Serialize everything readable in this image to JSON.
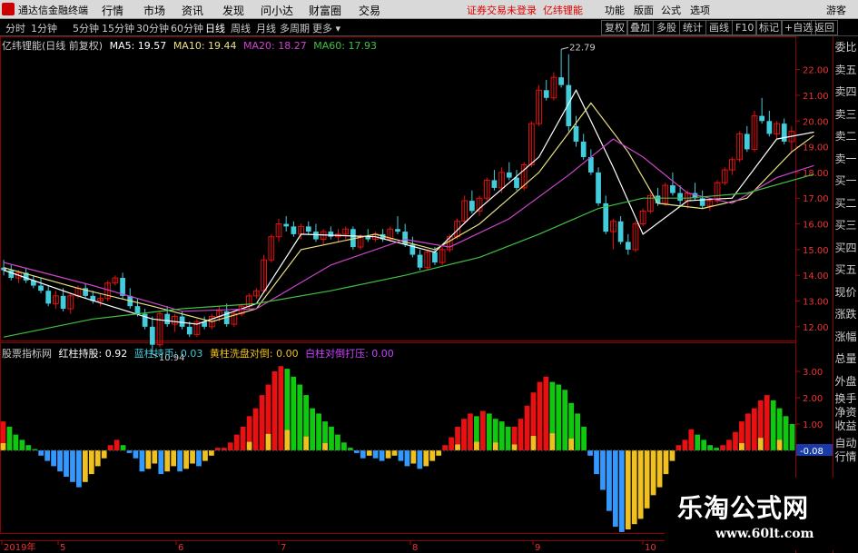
{
  "app": {
    "title": "通达信金融终端"
  },
  "menu": [
    "行情",
    "市场",
    "资讯",
    "发现",
    "问小达",
    "财富圈",
    "交易"
  ],
  "login_warning": "证券交易未登录",
  "stock_name": "亿纬锂能",
  "right_menu": [
    "功能",
    "版面",
    "公式",
    "选项"
  ],
  "guest": "游客",
  "periods": [
    "分时",
    "1分钟",
    "5分钟",
    "15分钟",
    "30分钟",
    "60分钟",
    "日线",
    "周线",
    "月线",
    "多周期",
    "更多"
  ],
  "active_period": "日线",
  "right_buttons": [
    "复权",
    "叠加",
    "多股",
    "统计",
    "画线",
    "F10",
    "标记",
    "+自选",
    "返回"
  ],
  "chart_header": {
    "title": "亿纬锂能(日线 前复权)",
    "ma5": "MA5: 19.57",
    "ma10": "MA10: 19.44",
    "ma20": "MA20: 18.27",
    "ma60": "MA60: 17.93"
  },
  "indicator_header": {
    "name": "股票指标网",
    "red": "红柱持股: 0.92",
    "blue": "蓝柱持币: 0.03",
    "yellow": "黄柱洗盘对倒: 0.00",
    "purple": "白柱对倒打压: 0.00"
  },
  "colors": {
    "red": "#e81010",
    "green": "#10c810",
    "cyan": "#44ccdd",
    "blue": "#3399ff",
    "yellow": "#f0c020",
    "purple": "#cc44ff",
    "ma5": "#ffffff",
    "ma10": "#e8e080",
    "ma20": "#cc44cc",
    "ma60": "#40c040"
  },
  "side_panel": [
    "委比",
    "卖五",
    "卖四",
    "卖三",
    "卖二",
    "卖一",
    "买一",
    "买二",
    "买三",
    "买四",
    "买五",
    "现价",
    "涨跌",
    "涨幅",
    "总量",
    "外盘",
    "换手",
    "净资",
    "收益",
    "自动",
    "行情"
  ],
  "price_axis": {
    "min": 11.5,
    "max": 22.8,
    "ticks": [
      "22.00",
      "21.00",
      "20.00",
      "19.00",
      "18.00",
      "17.00",
      "16.00",
      "15.00",
      "14.00",
      "13.00",
      "12.00"
    ]
  },
  "indicator_axis": {
    "ticks": [
      "3.00",
      "2.00",
      "1.00",
      "-0.08"
    ],
    "current_value": "-0.08"
  },
  "time_axis": [
    "2019年",
    "5",
    "6",
    "7",
    "8",
    "9",
    "10"
  ],
  "annotations": {
    "high": "22.79",
    "low": "10.94"
  },
  "watermark": {
    "title": "乐淘公式网",
    "url": "www.60lt.com"
  },
  "candles": [
    {
      "o": 14.3,
      "h": 14.6,
      "l": 14.0,
      "c": 14.2
    },
    {
      "o": 14.2,
      "h": 14.4,
      "l": 13.8,
      "c": 13.9
    },
    {
      "o": 13.9,
      "h": 14.2,
      "l": 13.7,
      "c": 14.1
    },
    {
      "o": 14.1,
      "h": 14.3,
      "l": 13.7,
      "c": 13.8
    },
    {
      "o": 13.8,
      "h": 14.0,
      "l": 13.5,
      "c": 13.6
    },
    {
      "o": 13.6,
      "h": 13.9,
      "l": 13.3,
      "c": 13.4
    },
    {
      "o": 13.4,
      "h": 13.6,
      "l": 12.8,
      "c": 12.9
    },
    {
      "o": 12.9,
      "h": 13.4,
      "l": 12.7,
      "c": 13.2
    },
    {
      "o": 13.2,
      "h": 13.5,
      "l": 12.6,
      "c": 12.7
    },
    {
      "o": 12.7,
      "h": 13.3,
      "l": 12.5,
      "c": 13.2
    },
    {
      "o": 13.2,
      "h": 13.6,
      "l": 13.1,
      "c": 13.5
    },
    {
      "o": 13.5,
      "h": 13.7,
      "l": 13.1,
      "c": 13.2
    },
    {
      "o": 13.2,
      "h": 13.4,
      "l": 12.9,
      "c": 13.0
    },
    {
      "o": 13.0,
      "h": 13.3,
      "l": 12.8,
      "c": 13.1
    },
    {
      "o": 13.1,
      "h": 13.8,
      "l": 13.0,
      "c": 13.7
    },
    {
      "o": 13.7,
      "h": 14.0,
      "l": 13.6,
      "c": 13.9
    },
    {
      "o": 13.9,
      "h": 14.1,
      "l": 13.1,
      "c": 13.2
    },
    {
      "o": 13.2,
      "h": 13.5,
      "l": 12.7,
      "c": 12.8
    },
    {
      "o": 12.8,
      "h": 13.1,
      "l": 12.4,
      "c": 12.5
    },
    {
      "o": 12.5,
      "h": 12.7,
      "l": 11.9,
      "c": 12.0
    },
    {
      "o": 12.0,
      "h": 12.4,
      "l": 10.94,
      "c": 11.3
    },
    {
      "o": 11.3,
      "h": 12.6,
      "l": 11.2,
      "c": 12.5
    },
    {
      "o": 12.5,
      "h": 12.8,
      "l": 12.0,
      "c": 12.1
    },
    {
      "o": 12.1,
      "h": 12.5,
      "l": 11.8,
      "c": 12.4
    },
    {
      "o": 12.4,
      "h": 12.6,
      "l": 11.9,
      "c": 12.0
    },
    {
      "o": 12.0,
      "h": 12.2,
      "l": 11.6,
      "c": 11.7
    },
    {
      "o": 11.7,
      "h": 12.3,
      "l": 11.6,
      "c": 12.2
    },
    {
      "o": 12.2,
      "h": 12.4,
      "l": 11.9,
      "c": 12.0
    },
    {
      "o": 12.0,
      "h": 12.5,
      "l": 11.9,
      "c": 12.4
    },
    {
      "o": 12.4,
      "h": 12.8,
      "l": 12.2,
      "c": 12.6
    },
    {
      "o": 12.6,
      "h": 12.9,
      "l": 12.0,
      "c": 12.1
    },
    {
      "o": 12.1,
      "h": 12.6,
      "l": 12.0,
      "c": 12.5
    },
    {
      "o": 12.5,
      "h": 12.9,
      "l": 12.4,
      "c": 12.8
    },
    {
      "o": 12.8,
      "h": 13.3,
      "l": 12.7,
      "c": 13.2
    },
    {
      "o": 13.2,
      "h": 13.5,
      "l": 13.1,
      "c": 13.4
    },
    {
      "o": 13.4,
      "h": 14.8,
      "l": 13.3,
      "c": 14.6
    },
    {
      "o": 14.6,
      "h": 15.6,
      "l": 14.5,
      "c": 15.5
    },
    {
      "o": 15.5,
      "h": 16.2,
      "l": 15.3,
      "c": 16.0
    },
    {
      "o": 16.0,
      "h": 16.3,
      "l": 15.7,
      "c": 15.9
    },
    {
      "o": 15.9,
      "h": 16.1,
      "l": 15.5,
      "c": 15.6
    },
    {
      "o": 15.6,
      "h": 16.0,
      "l": 15.4,
      "c": 15.9
    },
    {
      "o": 15.9,
      "h": 16.1,
      "l": 15.6,
      "c": 15.7
    },
    {
      "o": 15.7,
      "h": 16.0,
      "l": 15.3,
      "c": 15.4
    },
    {
      "o": 15.4,
      "h": 15.8,
      "l": 15.2,
      "c": 15.7
    },
    {
      "o": 15.7,
      "h": 15.9,
      "l": 15.4,
      "c": 15.5
    },
    {
      "o": 15.5,
      "h": 15.8,
      "l": 15.3,
      "c": 15.6
    },
    {
      "o": 15.6,
      "h": 15.9,
      "l": 15.4,
      "c": 15.8
    },
    {
      "o": 15.8,
      "h": 15.9,
      "l": 15.0,
      "c": 15.1
    },
    {
      "o": 15.1,
      "h": 15.6,
      "l": 15.0,
      "c": 15.5
    },
    {
      "o": 15.5,
      "h": 15.8,
      "l": 15.3,
      "c": 15.4
    },
    {
      "o": 15.4,
      "h": 15.7,
      "l": 15.3,
      "c": 15.6
    },
    {
      "o": 15.6,
      "h": 15.8,
      "l": 15.3,
      "c": 15.4
    },
    {
      "o": 15.4,
      "h": 15.9,
      "l": 15.3,
      "c": 15.8
    },
    {
      "o": 15.8,
      "h": 16.3,
      "l": 15.6,
      "c": 15.7
    },
    {
      "o": 15.7,
      "h": 16.0,
      "l": 15.1,
      "c": 15.2
    },
    {
      "o": 15.2,
      "h": 15.5,
      "l": 14.7,
      "c": 14.8
    },
    {
      "o": 14.8,
      "h": 15.0,
      "l": 14.2,
      "c": 14.3
    },
    {
      "o": 14.3,
      "h": 15.0,
      "l": 14.2,
      "c": 14.9
    },
    {
      "o": 14.9,
      "h": 15.1,
      "l": 14.4,
      "c": 14.5
    },
    {
      "o": 14.5,
      "h": 15.1,
      "l": 14.4,
      "c": 15.0
    },
    {
      "o": 15.0,
      "h": 15.6,
      "l": 14.9,
      "c": 15.5
    },
    {
      "o": 15.5,
      "h": 16.2,
      "l": 15.4,
      "c": 16.1
    },
    {
      "o": 16.1,
      "h": 17.1,
      "l": 16.0,
      "c": 16.9
    },
    {
      "o": 16.9,
      "h": 17.3,
      "l": 16.4,
      "c": 16.5
    },
    {
      "o": 16.5,
      "h": 17.1,
      "l": 16.3,
      "c": 17.0
    },
    {
      "o": 17.0,
      "h": 17.8,
      "l": 16.9,
      "c": 17.7
    },
    {
      "o": 17.7,
      "h": 18.1,
      "l": 17.3,
      "c": 17.4
    },
    {
      "o": 17.4,
      "h": 18.2,
      "l": 17.2,
      "c": 18.0
    },
    {
      "o": 18.0,
      "h": 18.4,
      "l": 17.7,
      "c": 17.8
    },
    {
      "o": 17.8,
      "h": 18.1,
      "l": 17.3,
      "c": 17.4
    },
    {
      "o": 17.4,
      "h": 18.4,
      "l": 17.3,
      "c": 18.3
    },
    {
      "o": 18.3,
      "h": 20.0,
      "l": 18.2,
      "c": 19.9
    },
    {
      "o": 19.9,
      "h": 21.4,
      "l": 19.8,
      "c": 21.2
    },
    {
      "o": 21.2,
      "h": 21.6,
      "l": 20.8,
      "c": 20.9
    },
    {
      "o": 20.9,
      "h": 21.9,
      "l": 20.8,
      "c": 21.7
    },
    {
      "o": 21.7,
      "h": 22.79,
      "l": 21.3,
      "c": 21.4
    },
    {
      "o": 21.4,
      "h": 22.6,
      "l": 19.6,
      "c": 19.8
    },
    {
      "o": 19.8,
      "h": 20.2,
      "l": 19.0,
      "c": 19.2
    },
    {
      "o": 19.2,
      "h": 19.5,
      "l": 18.5,
      "c": 18.6
    },
    {
      "o": 18.6,
      "h": 18.9,
      "l": 17.9,
      "c": 18.0
    },
    {
      "o": 18.0,
      "h": 18.2,
      "l": 16.7,
      "c": 16.8
    },
    {
      "o": 16.8,
      "h": 17.1,
      "l": 15.6,
      "c": 15.7
    },
    {
      "o": 15.7,
      "h": 16.2,
      "l": 15.0,
      "c": 16.1
    },
    {
      "o": 16.1,
      "h": 16.3,
      "l": 15.2,
      "c": 15.3
    },
    {
      "o": 15.3,
      "h": 15.6,
      "l": 14.8,
      "c": 15.0
    },
    {
      "o": 15.0,
      "h": 16.1,
      "l": 14.9,
      "c": 16.0
    },
    {
      "o": 16.0,
      "h": 16.6,
      "l": 15.9,
      "c": 16.5
    },
    {
      "o": 16.5,
      "h": 17.2,
      "l": 16.4,
      "c": 17.1
    },
    {
      "o": 17.1,
      "h": 17.4,
      "l": 16.7,
      "c": 16.8
    },
    {
      "o": 16.8,
      "h": 17.6,
      "l": 16.7,
      "c": 17.5
    },
    {
      "o": 17.5,
      "h": 18.0,
      "l": 17.1,
      "c": 17.2
    },
    {
      "o": 17.2,
      "h": 17.5,
      "l": 16.7,
      "c": 16.9
    },
    {
      "o": 16.9,
      "h": 17.3,
      "l": 16.6,
      "c": 17.2
    },
    {
      "o": 17.2,
      "h": 17.6,
      "l": 16.9,
      "c": 17.0
    },
    {
      "o": 17.0,
      "h": 17.3,
      "l": 16.6,
      "c": 16.7
    },
    {
      "o": 16.7,
      "h": 17.0,
      "l": 16.5,
      "c": 16.9
    },
    {
      "o": 16.9,
      "h": 17.7,
      "l": 16.8,
      "c": 17.6
    },
    {
      "o": 17.6,
      "h": 18.2,
      "l": 17.5,
      "c": 18.1
    },
    {
      "o": 18.1,
      "h": 18.6,
      "l": 17.9,
      "c": 18.5
    },
    {
      "o": 18.5,
      "h": 19.6,
      "l": 18.4,
      "c": 19.5
    },
    {
      "o": 19.5,
      "h": 19.8,
      "l": 18.8,
      "c": 18.9
    },
    {
      "o": 18.9,
      "h": 20.4,
      "l": 18.8,
      "c": 20.2
    },
    {
      "o": 20.2,
      "h": 20.9,
      "l": 19.9,
      "c": 20.0
    },
    {
      "o": 20.0,
      "h": 20.4,
      "l": 19.4,
      "c": 19.5
    },
    {
      "o": 19.5,
      "h": 20.0,
      "l": 19.3,
      "c": 19.9
    },
    {
      "o": 19.9,
      "h": 20.1,
      "l": 19.1,
      "c": 19.2
    },
    {
      "o": 19.2,
      "h": 19.8,
      "l": 18.8,
      "c": 19.6
    }
  ],
  "ma": {
    "ma5": [
      [
        0,
        14.2
      ],
      [
        10,
        13.2
      ],
      [
        20,
        12.3
      ],
      [
        26,
        12.1
      ],
      [
        34,
        12.9
      ],
      [
        40,
        15.6
      ],
      [
        50,
        15.5
      ],
      [
        58,
        14.9
      ],
      [
        64,
        16.6
      ],
      [
        72,
        18.6
      ],
      [
        77,
        21.2
      ],
      [
        82,
        18.2
      ],
      [
        86,
        15.6
      ],
      [
        92,
        16.9
      ],
      [
        98,
        17.0
      ],
      [
        104,
        19.3
      ],
      [
        109,
        19.57
      ]
    ],
    "ma10": [
      [
        0,
        14.3
      ],
      [
        10,
        13.5
      ],
      [
        20,
        12.8
      ],
      [
        28,
        12.2
      ],
      [
        34,
        12.7
      ],
      [
        40,
        15.0
      ],
      [
        50,
        15.6
      ],
      [
        58,
        15.0
      ],
      [
        64,
        16.0
      ],
      [
        72,
        18.0
      ],
      [
        79,
        20.7
      ],
      [
        84,
        18.8
      ],
      [
        88,
        16.8
      ],
      [
        94,
        16.6
      ],
      [
        100,
        17.0
      ],
      [
        106,
        18.8
      ],
      [
        109,
        19.44
      ]
    ],
    "ma20": [
      [
        0,
        14.5
      ],
      [
        12,
        13.6
      ],
      [
        24,
        12.6
      ],
      [
        34,
        12.7
      ],
      [
        44,
        14.4
      ],
      [
        54,
        15.4
      ],
      [
        60,
        15.1
      ],
      [
        68,
        16.2
      ],
      [
        76,
        17.9
      ],
      [
        82,
        19.3
      ],
      [
        86,
        18.6
      ],
      [
        92,
        17.2
      ],
      [
        98,
        16.8
      ],
      [
        104,
        17.8
      ],
      [
        109,
        18.27
      ]
    ],
    "ma60": [
      [
        0,
        11.6
      ],
      [
        12,
        12.3
      ],
      [
        24,
        12.7
      ],
      [
        34,
        12.9
      ],
      [
        44,
        13.4
      ],
      [
        54,
        14.0
      ],
      [
        64,
        14.7
      ],
      [
        72,
        15.6
      ],
      [
        80,
        16.6
      ],
      [
        86,
        17.0
      ],
      [
        92,
        17.0
      ],
      [
        100,
        17.2
      ],
      [
        109,
        17.93
      ]
    ]
  },
  "histogram": [
    1.1,
    0.9,
    0.6,
    0.4,
    0.2,
    0.05,
    -0.2,
    -0.4,
    -0.6,
    -0.8,
    -1.0,
    -1.2,
    -1.4,
    -1.2,
    -0.9,
    -0.6,
    -0.3,
    0.2,
    0.4,
    0.2,
    -0.1,
    -0.3,
    -0.8,
    -0.7,
    -0.5,
    -0.9,
    -0.8,
    -0.6,
    -0.8,
    -0.7,
    -0.5,
    -0.6,
    -0.4,
    -0.2,
    0.1,
    0.1,
    0.3,
    0.6,
    0.9,
    1.3,
    1.6,
    2.1,
    2.5,
    3.0,
    3.2,
    3.1,
    2.8,
    2.5,
    2.1,
    1.6,
    1.4,
    1.1,
    0.9,
    0.6,
    0.3,
    0.1,
    -0.1,
    -0.3,
    -0.2,
    -0.3,
    -0.4,
    -0.3,
    -0.2,
    -0.4,
    -0.6,
    -0.5,
    -0.7,
    -0.6,
    -0.4,
    -0.2,
    0.2,
    0.5,
    0.9,
    1.2,
    1.4,
    1.3,
    1.5,
    1.4,
    1.2,
    1.1,
    0.9,
    0.9,
    1.2,
    1.7,
    2.2,
    2.6,
    2.8,
    2.6,
    2.5,
    2.3,
    1.8,
    1.4,
    0.9,
    -0.2,
    -0.9,
    -1.5,
    -2.3,
    -2.9,
    -3.1,
    -3.0,
    -2.8,
    -2.6,
    -2.2,
    -1.7,
    -1.4,
    -0.9,
    -0.4,
    0.2,
    0.4,
    0.8,
    0.6,
    0.4,
    0.2,
    0.1,
    0.2,
    0.4,
    0.7,
    1.1,
    1.4,
    1.6,
    1.9,
    2.1,
    1.9,
    1.6,
    1.3,
    1.0
  ]
}
